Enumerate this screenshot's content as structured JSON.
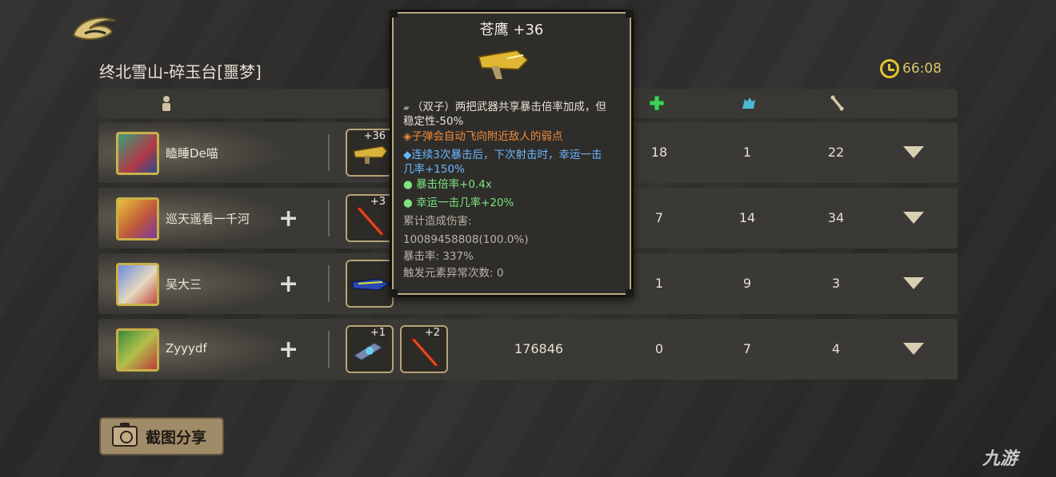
{
  "header": {
    "stage_title": "终北雪山-碎玉台[噩梦]",
    "timer": "66:08"
  },
  "columns": {
    "player_icon": "player-icon",
    "heal_icon": "green-cross-icon",
    "pet_icon": "pet-icon",
    "bone_icon": "bone-icon"
  },
  "players": [
    {
      "name": "瞌睡De喵",
      "has_add": false,
      "weapons": [
        {
          "level": "+36",
          "type": "crossbow"
        }
      ],
      "damage": "",
      "heal": "18",
      "pet": "1",
      "bone": "22"
    },
    {
      "name": "巡天遥看一千河",
      "has_add": true,
      "weapons": [
        {
          "level": "+3",
          "type": "spear"
        }
      ],
      "damage": "",
      "heal": "7",
      "pet": "14",
      "bone": "34"
    },
    {
      "name": "吴大三",
      "has_add": true,
      "weapons": [
        {
          "level": "",
          "type": "rifle"
        }
      ],
      "damage": "",
      "heal": "1",
      "pet": "9",
      "bone": "3"
    },
    {
      "name": "Zyyydf",
      "has_add": true,
      "weapons": [
        {
          "level": "+1",
          "type": "cannon"
        },
        {
          "level": "+2",
          "type": "spear"
        }
      ],
      "damage": "176846",
      "heal": "0",
      "pet": "7",
      "bone": "4"
    }
  ],
  "tooltip": {
    "title": "苍鹰 +36",
    "lines": [
      {
        "text": "（双子）两把武器共享暴击倍率加成，但",
        "color": "white",
        "prefix": "gun-icon"
      },
      {
        "text": "稳定性-50%",
        "color": "white"
      },
      {
        "text": "◈子弹会自动飞向附近敌人的弱点",
        "color": "orange"
      },
      {
        "text": "◆连续3次暴击后，下次射击时，幸运一击",
        "color": "blue"
      },
      {
        "text": "几率+150%",
        "color": "blue"
      },
      {
        "text": "● 暴击倍率+0.4x",
        "color": "green"
      },
      {
        "text": "● 幸运一击几率+20%",
        "color": "green"
      },
      {
        "text": "累计造成伤害:",
        "color": "grey"
      },
      {
        "text": "10089458808(100.0%)",
        "color": "grey"
      },
      {
        "text": "暴击率: 337%",
        "color": "grey"
      },
      {
        "text": "触发元素异常次数: 0",
        "color": "grey"
      }
    ]
  },
  "footer": {
    "share_label": "截图分享",
    "watermark": "九游"
  },
  "colors": {
    "accent_gold": "#c8b14a",
    "timer_yellow": "#e3c531",
    "orange": "#f08a3a",
    "blue": "#6bb7ff",
    "green": "#7fe37f"
  }
}
